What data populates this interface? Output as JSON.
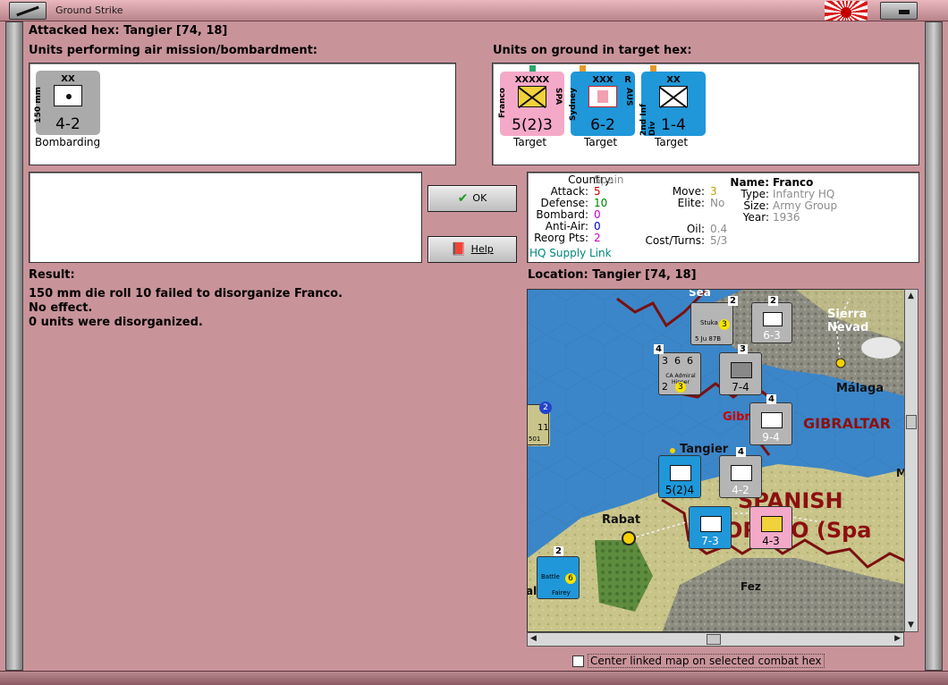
{
  "window": {
    "title": "Ground Strike"
  },
  "attacked_hex": "Attacked hex: Tangier  [74, 18]",
  "air_units": {
    "header": "Units performing air mission/bombardment:",
    "units": [
      {
        "size": "XX",
        "name": "150 mm",
        "strength": "4-2",
        "status": "Bombarding"
      }
    ]
  },
  "ground_units": {
    "header": "Units on ground in target hex:",
    "units": [
      {
        "size": "XXXXX",
        "name": "Franco",
        "nation": "SPA",
        "strength": "5(2)3",
        "status": "Target",
        "color": "#f4a9c8"
      },
      {
        "size": "XXX",
        "name": "Sydney",
        "nation": "AUS",
        "badge": "R",
        "strength": "6-2",
        "status": "Target",
        "color": "#1f97d9"
      },
      {
        "size": "XX",
        "name": "2nd Inf Div",
        "strength": "1-4",
        "status": "Target",
        "color": "#1f97d9"
      }
    ]
  },
  "buttons": {
    "ok": "OK",
    "help": "Help"
  },
  "unit_info": {
    "labels": {
      "country": "Country:",
      "attack": "Attack:",
      "defense": "Defense:",
      "bombard": "Bombard:",
      "anti_air": "Anti-Air:",
      "reorg": "Reorg Pts:",
      "move": "Move:",
      "elite": "Elite:",
      "oil": "Oil:",
      "cost": "Cost/Turns:",
      "name": "Name:",
      "type": "Type:",
      "size": "Size:",
      "year": "Year:"
    },
    "values": {
      "country": "Spain",
      "attack": "5",
      "defense": "10",
      "bombard": "0",
      "anti_air": "0",
      "reorg": "2",
      "move": "3",
      "elite": "No",
      "oil": "0.4",
      "cost": "5/3",
      "name": "Franco",
      "type": "Infantry HQ",
      "size": "Army Group",
      "year": "1936"
    },
    "supply_link": "HQ Supply Link"
  },
  "result": {
    "header": "Result:",
    "lines": [
      "150 mm die roll 10 failed to disorganize Franco.",
      "No effect.",
      "0 units were disorganized."
    ]
  },
  "location": "Location:  Tangier  [74, 18]",
  "map": {
    "labels": {
      "sierra": "Sierra Nevad",
      "malaga": "Málaga",
      "gibraltar": "GIBRALTAR",
      "gib_city": "Gibr",
      "tangier": "Tangier",
      "spanish": "SPANISH",
      "morocco": "ORCCO (Spa",
      "rabat": "Rabat",
      "fez": "Fez",
      "sea": "Sea",
      "m": "M"
    },
    "counters": {
      "stuka": {
        "name": "Stuka",
        "sub": "5 Ju 87B",
        "stack": "2",
        "val": "3"
      },
      "mech": {
        "strength": "6-3",
        "stack": "2"
      },
      "ship": {
        "name": "CA Admiral Hipper",
        "top": "3  6  6",
        "bottom": "2",
        "val": "3",
        "stack": "4"
      },
      "inf74": {
        "strength": "7-4",
        "stack": "3"
      },
      "inf94": {
        "strength": "9-4",
        "stack": "4"
      },
      "franco_map": {
        "strength": "5(2)4"
      },
      "mm150": {
        "strength": "4-2",
        "stack": "4"
      },
      "inf73": {
        "strength": "7-3"
      },
      "spa43": {
        "strength": "4-3"
      },
      "left_air": {
        "val": "11",
        "sub": "501",
        "stack": "2"
      },
      "fairey": {
        "name": "Battle",
        "sub": "Fairey",
        "val": "6",
        "stack": "2",
        "edge": "al"
      }
    }
  },
  "checkbox": {
    "label": "Center linked map on selected combat hex",
    "checked": false
  }
}
